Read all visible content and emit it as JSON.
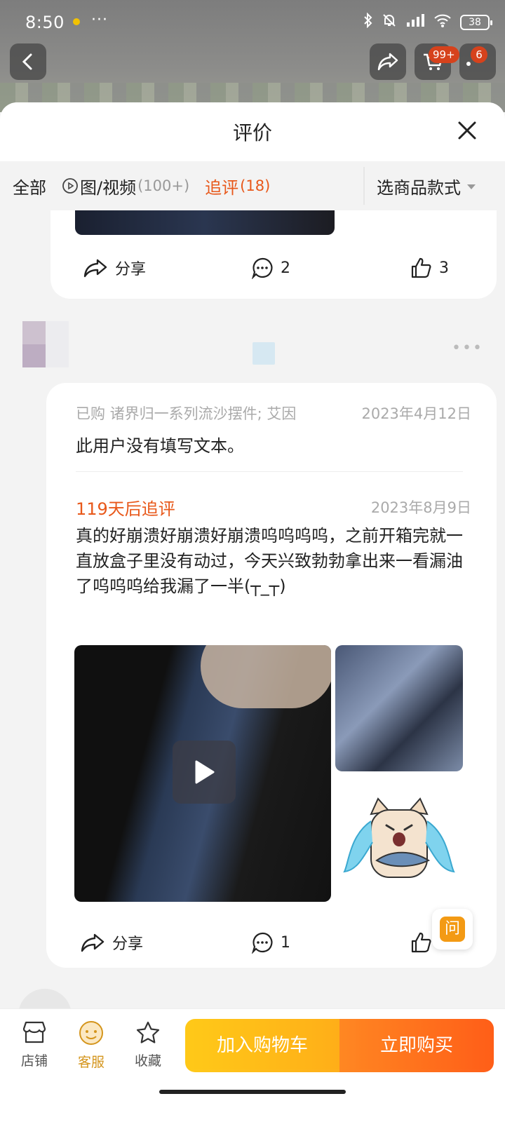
{
  "status_bar": {
    "time": "8:50",
    "more": "···",
    "battery": "38"
  },
  "top_nav": {
    "cart_badge": "99+",
    "message_badge": "6"
  },
  "sheet": {
    "title": "评价"
  },
  "filters": [
    {
      "label": "全部",
      "count": ""
    },
    {
      "label": "图/视频",
      "count": "(100+)"
    },
    {
      "label": "追评",
      "count": "(18)"
    }
  ],
  "variant_select": {
    "label": "选商品款式"
  },
  "card_1": {
    "share": "分享",
    "comments": "2",
    "likes": "3"
  },
  "review_2": {
    "purchase_info": "已购 诸界归一系列流沙摆件; 艾因",
    "purchase_date": "2023年4月12日",
    "text": "此用户没有填写文本。",
    "followup_label": "119天后追评",
    "followup_date": "2023年8月9日",
    "followup_text": "真的好崩溃好崩溃好崩溃呜呜呜呜，之前开箱完就一直放盒子里没有动过，今天兴致勃勃拿出来一看漏油了呜呜呜给我漏了一半(┬_┬)",
    "share": "分享",
    "comments": "1"
  },
  "float_button": {
    "label": "问"
  },
  "bottom_bar": {
    "store": "店铺",
    "service": "客服",
    "favorite": "收藏",
    "add_to_cart": "加入购物车",
    "buy_now": "立即购买"
  },
  "colors": {
    "accent_orange": "#e8581a",
    "cart_yellow": "#ffc400",
    "buy_orange": "#ff4d00"
  }
}
